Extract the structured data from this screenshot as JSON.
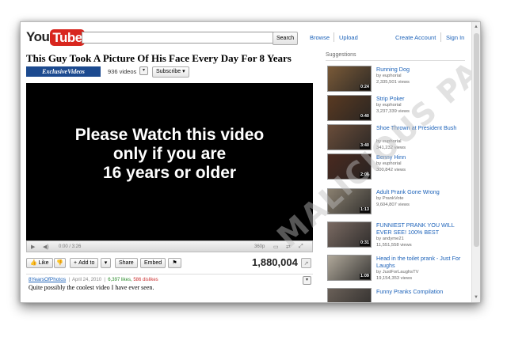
{
  "header": {
    "logo_you": "You",
    "logo_tube": "Tube",
    "search_value": "",
    "search_button": "Search",
    "nav": [
      "Browse",
      "Upload"
    ],
    "account": [
      "Create Account",
      "Sign In"
    ]
  },
  "video": {
    "title": "This Guy Took A Picture Of His Face Every Day For 8 Years",
    "channel_badge": "ExclusiveVideos",
    "video_count": "936 videos",
    "subscribe": "Subscribe",
    "warning_lines": [
      "Please Watch this video",
      "only if you are",
      "16 years or older"
    ],
    "time": "0:00 / 3:26",
    "quality": "360p",
    "like": "Like",
    "add_to": "Add to",
    "share": "Share",
    "embed": "Embed",
    "views": "1,880,004",
    "uploader": "8YearsOfPhotos",
    "date": "April 24, 2010",
    "likes": "6,397 likes,",
    "dislikes": "586 dislikes",
    "description": "Quite possibly the coolest video I have ever seen."
  },
  "suggestions": {
    "header": "Suggestions",
    "items": [
      {
        "title": "Running Dog",
        "by": "by euphorial",
        "views": "2,335,501 views",
        "duration": "0:24",
        "color": "#7a5a38"
      },
      {
        "title": "Strip Poker",
        "by": "by euphorial",
        "views": "3,237,339 views",
        "duration": "0:40",
        "color": "#5a3a22"
      },
      {
        "title": "Shoe Thrown at President Bush",
        "by": "by euphorial",
        "views": "341,232 views",
        "duration": "3:40",
        "color": "#6a4d3a"
      },
      {
        "title": "Benny Hinn",
        "by": "by euphorial",
        "views": "300,842 views",
        "duration": "2:06",
        "color": "#4a2a20"
      },
      {
        "title": "Adult Prank Gone Wrong",
        "by": "by PrankVote",
        "views": "9,604,807 views",
        "duration": "1:13",
        "color": "#8a8070"
      },
      {
        "title": "FUNNIEST PRANK YOU WILL EVER SEE! 100% BEST",
        "by": "by andyme21",
        "views": "11,551,558 views",
        "duration": "0:31",
        "color": "#7a6a62"
      },
      {
        "title": "Head in the toilet prank - Just For Laughs",
        "by": "by JustForLaughsTV",
        "views": "19,154,353 views",
        "duration": "1:09",
        "color": "#b0a89a"
      },
      {
        "title": "Funny Pranks Compilation",
        "by": "",
        "views": "",
        "duration": "",
        "color": "#6a6058"
      }
    ]
  },
  "watermark": "MALICIOUS PAGE",
  "colors": {
    "link": "#1c62b9",
    "logo_red": "#d8261e",
    "badge": "#1c4a8f"
  }
}
